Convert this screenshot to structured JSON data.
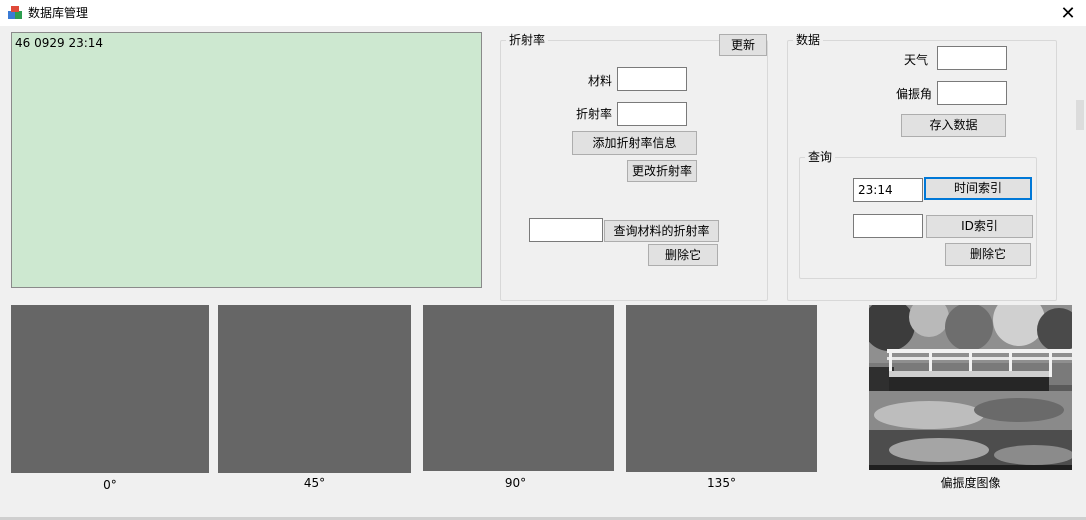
{
  "window": {
    "title": "数据库管理",
    "close_glyph": "✕"
  },
  "log": {
    "text": "46 0929 23:14"
  },
  "refraction": {
    "group_title": "折射率",
    "refresh_button": "更新",
    "material_label": "材料",
    "material_value": "",
    "index_label": "折射率",
    "index_value": "",
    "add_button": "添加折射率信息",
    "modify_button": "更改折射率",
    "query_value": "",
    "query_button": "查询材料的折射率",
    "delete_button": "删除它"
  },
  "data": {
    "group_title": "数据",
    "weather_label": "天气",
    "weather_value": "",
    "polar_angle_label": "偏振角",
    "polar_angle_value": "",
    "save_button": "存入数据",
    "query": {
      "group_title": "查询",
      "time_value": "23:14",
      "time_button": "时间索引",
      "id_value": "",
      "id_button": "ID索引",
      "delete_button": "删除它"
    }
  },
  "images": {
    "angles": [
      "0°",
      "45°",
      "90°",
      "135°"
    ],
    "polarization_caption": "偏振度图像"
  },
  "colors": {
    "log_bg": "#cde8d0",
    "placeholder_gray": "#666666",
    "focus_border": "#0078d7"
  }
}
